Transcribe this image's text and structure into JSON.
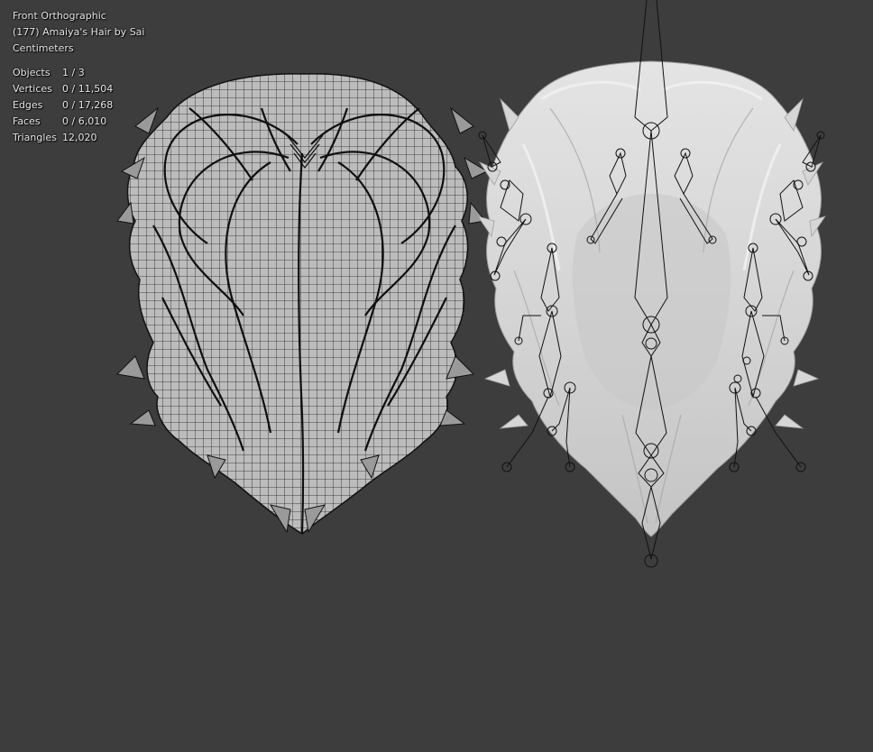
{
  "overlay": {
    "view_name": "Front Orthographic",
    "object_name": "(177) Amaiya's Hair by Sai",
    "units": "Centimeters"
  },
  "stats": [
    {
      "label": "Objects",
      "value": "1 / 3"
    },
    {
      "label": "Vertices",
      "value": "0 / 11,504"
    },
    {
      "label": "Edges",
      "value": "0 / 17,268"
    },
    {
      "label": "Faces",
      "value": "0 / 6,010"
    },
    {
      "label": "Triangles",
      "value": "12,020"
    }
  ],
  "colors": {
    "viewport_bg": "#3d3d3d",
    "mesh_fill": "#bdbdbd",
    "wire": "#161616",
    "shaded_hair": "#dcdcdc"
  }
}
